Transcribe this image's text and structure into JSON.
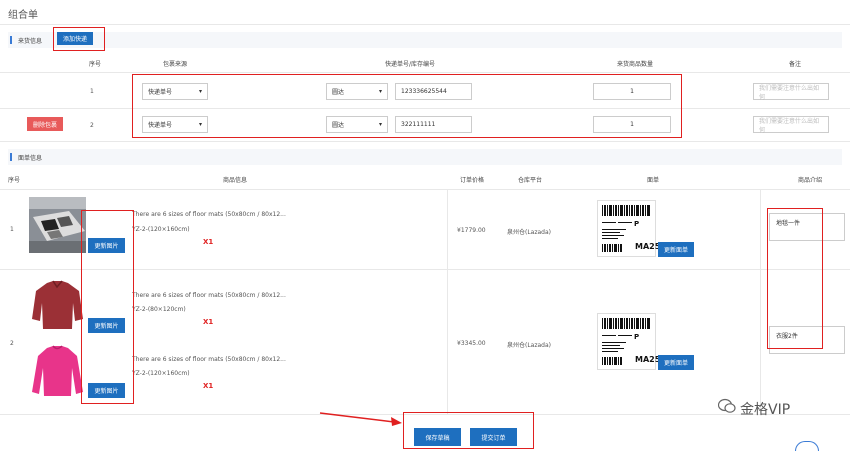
{
  "page_title": "组合单",
  "incoming": {
    "section_label": "来货信息",
    "add_button": "添加快递",
    "headers": [
      "序号",
      "包裹来源",
      "快递单号/库存编号",
      "来货商品数量",
      "备注"
    ],
    "delete_button": "删除包裹",
    "rows": [
      {
        "index": "1",
        "source": "快递单号",
        "carrier": "圆达",
        "tracking": "123336625544",
        "qty": "1",
        "remark_placeholder": "我们需要注意什么出如何"
      },
      {
        "index": "2",
        "source": "快递单号",
        "carrier": "圆达",
        "tracking": "322111111",
        "qty": "1",
        "remark_placeholder": "我们需要注意什么出如何"
      }
    ]
  },
  "order": {
    "section_label": "面单信息",
    "headers": [
      "序号",
      "商品信息",
      "订单价格",
      "仓库平台",
      "面单",
      "商品介绍"
    ],
    "update_image_button": "更新图片",
    "update_label_button": "更新面单",
    "rows": [
      {
        "index": "1",
        "products": [
          {
            "title": "There are 6 sizes of floor mats (50x80cm / 80x12...",
            "sku": "YZ-2-(120×160cm)",
            "qty": "X1"
          }
        ],
        "price": "¥1779.00",
        "warehouse": "泉州仓(Lazada)",
        "label_code": "MA25",
        "intro": "地毯一件"
      },
      {
        "index": "2",
        "products": [
          {
            "title": "There are 6 sizes of floor mats (50x80cm / 80x12...",
            "sku": "YZ-2-(80×120cm)",
            "qty": "X1"
          },
          {
            "title": "There are 6 sizes of floor mats (50x80cm / 80x12...",
            "sku": "YZ-2-(120×160cm)",
            "qty": "X1"
          }
        ],
        "price": "¥3345.00",
        "warehouse": "泉州仓(Lazada)",
        "label_code": "MA25",
        "intro": "衣服2件"
      }
    ]
  },
  "actions": {
    "save_draft": "保存草稿",
    "submit_order": "提交订单"
  },
  "watermark": "金格VIP",
  "colors": {
    "primary": "#1e6fbf",
    "danger": "#e85a5a",
    "highlight": "#e02020"
  }
}
